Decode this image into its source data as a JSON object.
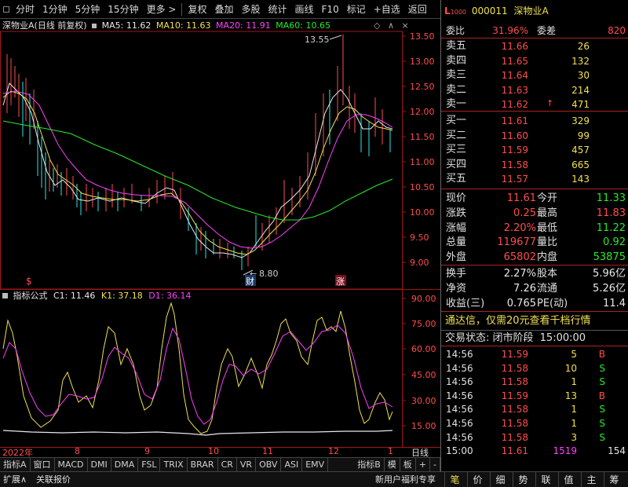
{
  "toolbar": {
    "items": [
      "分时",
      "1分钟",
      "5分钟",
      "15分钟",
      "更多 >",
      "复权",
      "叠加",
      "多股",
      "统计",
      "画线",
      "F10",
      "标记",
      "+自选",
      "返回"
    ]
  },
  "chart": {
    "stock_label": "深物业A(日线 前复权)",
    "ma5": "MA5: 11.62",
    "ma10": "MA10: 11.63",
    "ma20": "MA20: 11.91",
    "ma60": "MA60: 10.65",
    "price_ticks": [
      "13.50",
      "13.00",
      "12.50",
      "12.00",
      "11.50",
      "11.00",
      "10.50",
      "10.00",
      "9.50",
      "9.00"
    ],
    "high_mark": "13.55",
    "low_mark": "8.80",
    "marker_fin": "财",
    "marker_up": "涨",
    "marker_s": "$"
  },
  "indicator": {
    "name": "指标公式",
    "c1": "C1: 11.46",
    "k1": "K1: 37.18",
    "d1": "D1: 36.14",
    "ticks": [
      "90.00",
      "75.00",
      "60.00",
      "45.00",
      "30.00",
      "15.00"
    ]
  },
  "xaxis": {
    "labels": [
      "2022年",
      "8",
      "9",
      "10",
      "11",
      "12",
      "1"
    ],
    "period": "日线"
  },
  "tabs": {
    "items": [
      "指标A",
      "窗口",
      "MACD",
      "DMI",
      "DMA",
      "FSL",
      "TRIX",
      "BRAR",
      "CR",
      "VR",
      "OBV",
      "ASI",
      "EMV"
    ],
    "right": [
      "指标B",
      "模",
      "板",
      "+",
      "-"
    ]
  },
  "status": {
    "expand": "扩展∧",
    "related": "关联报价",
    "promo": "新用户福利专享"
  },
  "quote": {
    "code": "000011",
    "name": "深物业A",
    "wei_bi_label": "委比",
    "wei_bi": "31.96%",
    "wei_cha_label": "委差",
    "wei_cha": "820",
    "asks": [
      {
        "label": "卖五",
        "price": "11.66",
        "vol": "26"
      },
      {
        "label": "卖四",
        "price": "11.65",
        "vol": "132"
      },
      {
        "label": "卖三",
        "price": "11.64",
        "vol": "30"
      },
      {
        "label": "卖二",
        "price": "11.63",
        "vol": "214"
      },
      {
        "label": "卖一",
        "price": "11.62",
        "vol": "471"
      }
    ],
    "bids": [
      {
        "label": "买一",
        "price": "11.61",
        "vol": "329"
      },
      {
        "label": "买二",
        "price": "11.60",
        "vol": "99"
      },
      {
        "label": "买三",
        "price": "11.59",
        "vol": "457"
      },
      {
        "label": "买四",
        "price": "11.58",
        "vol": "665"
      },
      {
        "label": "买五",
        "price": "11.57",
        "vol": "143"
      }
    ],
    "stats": [
      {
        "l1": "现价",
        "v1": "11.61",
        "l2": "今开",
        "v2": "11.33"
      },
      {
        "l1": "涨跌",
        "v1": "0.25",
        "l2": "最高",
        "v2": "11.83"
      },
      {
        "l1": "涨幅",
        "v1": "2.20%",
        "l2": "最低",
        "v2": "11.22"
      },
      {
        "l1": "总量",
        "v1": "119677",
        "l2": "量比",
        "v2": "0.92"
      },
      {
        "l1": "外盘",
        "v1": "65802",
        "l2": "内盘",
        "v2": "53875"
      }
    ],
    "stats2": [
      {
        "l1": "换手",
        "v1": "2.27%",
        "l2": "股本",
        "v2": "5.96亿"
      },
      {
        "l1": "净资",
        "v1": "7.26",
        "l2": "流通",
        "v2": "5.26亿"
      },
      {
        "l1": "收益(三)",
        "v1": "0.765",
        "l2": "PE(动)",
        "v2": "11.4"
      }
    ],
    "promo": "通达信，仅需20元查看千档行情",
    "trade_status_label": "交易状态: 闭市阶段",
    "trade_status_time": "15:00:00",
    "ticks": [
      {
        "t": "14:56",
        "p": "11.59",
        "v": "5",
        "s": "B"
      },
      {
        "t": "14:56",
        "p": "11.58",
        "v": "10",
        "s": "S"
      },
      {
        "t": "14:56",
        "p": "11.58",
        "v": "1",
        "s": "S"
      },
      {
        "t": "14:56",
        "p": "11.59",
        "v": "13",
        "s": "B"
      },
      {
        "t": "14:56",
        "p": "11.58",
        "v": "1",
        "s": "S"
      },
      {
        "t": "14:56",
        "p": "11.58",
        "v": "1",
        "s": "S"
      },
      {
        "t": "14:56",
        "p": "11.58",
        "v": "3",
        "s": "S"
      },
      {
        "t": "15:00",
        "p": "11.61",
        "v": "1519",
        "s": "154"
      }
    ],
    "side_tabs": [
      "笔",
      "价",
      "细",
      "势",
      "联",
      "值",
      "主",
      "筹"
    ]
  }
}
